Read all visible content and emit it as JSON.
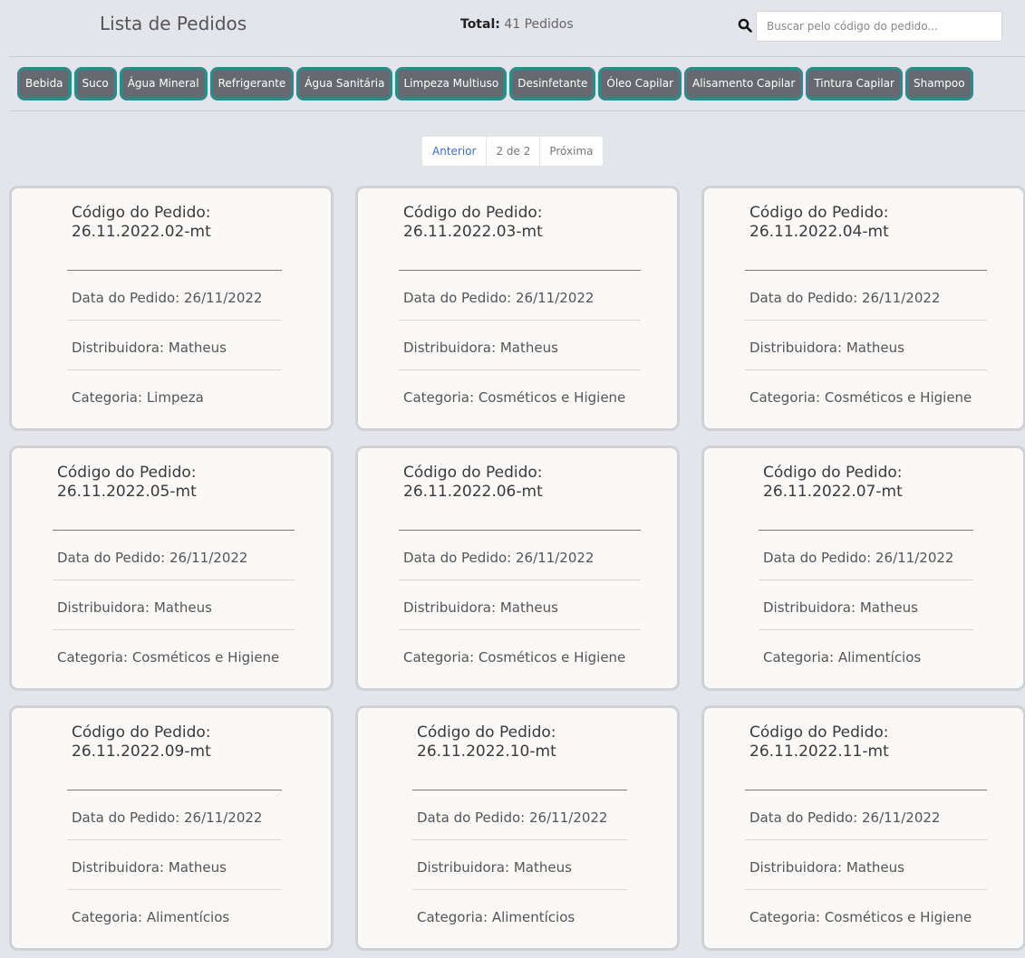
{
  "header": {
    "title": "Lista de Pedidos",
    "total_label": "Total:",
    "total_value": "41 Pedidos"
  },
  "search": {
    "placeholder": "Buscar pelo código do pedido...",
    "value": "",
    "icon": "search-icon"
  },
  "categories": [
    "Bebida",
    "Suco",
    "Água Mineral",
    "Refrigerante",
    "Água Sanitária",
    "Limpeza Multiuso",
    "Desinfetante",
    "Óleo Capilar",
    "Alisamento Capilar",
    "Tintura Capilar",
    "Shampoo"
  ],
  "pagination": {
    "prev": "Anterior",
    "current": "2 de 2",
    "next": "Próxima"
  },
  "orders": [
    {
      "code_label": "Código do Pedido:",
      "code": "26.11.2022.02-mt",
      "date": "Data do Pedido: 26/11/2022",
      "distributor": "Distribuidora: Matheus",
      "category": "Categoria: Limpeza"
    },
    {
      "code_label": "Código do Pedido:",
      "code": "26.11.2022.03-mt",
      "date": "Data do Pedido: 26/11/2022",
      "distributor": "Distribuidora: Matheus",
      "category": "Categoria: Cosméticos e Higiene"
    },
    {
      "code_label": "Código do Pedido:",
      "code": "26.11.2022.04-mt",
      "date": "Data do Pedido: 26/11/2022",
      "distributor": "Distribuidora: Matheus",
      "category": "Categoria: Cosméticos e Higiene"
    },
    {
      "code_label": "Código do Pedido:",
      "code": "26.11.2022.05-mt",
      "date": "Data do Pedido: 26/11/2022",
      "distributor": "Distribuidora: Matheus",
      "category": "Categoria: Cosméticos e Higiene"
    },
    {
      "code_label": "Código do Pedido:",
      "code": "26.11.2022.06-mt",
      "date": "Data do Pedido: 26/11/2022",
      "distributor": "Distribuidora: Matheus",
      "category": "Categoria: Cosméticos e Higiene"
    },
    {
      "code_label": "Código do Pedido:",
      "code": "26.11.2022.07-mt",
      "date": "Data do Pedido: 26/11/2022",
      "distributor": "Distribuidora: Matheus",
      "category": "Categoria: Alimentícios"
    },
    {
      "code_label": "Código do Pedido:",
      "code": "26.11.2022.09-mt",
      "date": "Data do Pedido: 26/11/2022",
      "distributor": "Distribuidora: Matheus",
      "category": "Categoria: Alimentícios"
    },
    {
      "code_label": "Código do Pedido:",
      "code": "26.11.2022.10-mt",
      "date": "Data do Pedido: 26/11/2022",
      "distributor": "Distribuidora: Matheus",
      "category": "Categoria: Alimentícios"
    },
    {
      "code_label": "Código do Pedido:",
      "code": "26.11.2022.11-mt",
      "date": "Data do Pedido: 26/11/2022",
      "distributor": "Distribuidora: Matheus",
      "category": "Categoria: Cosméticos e Higiene"
    }
  ]
}
